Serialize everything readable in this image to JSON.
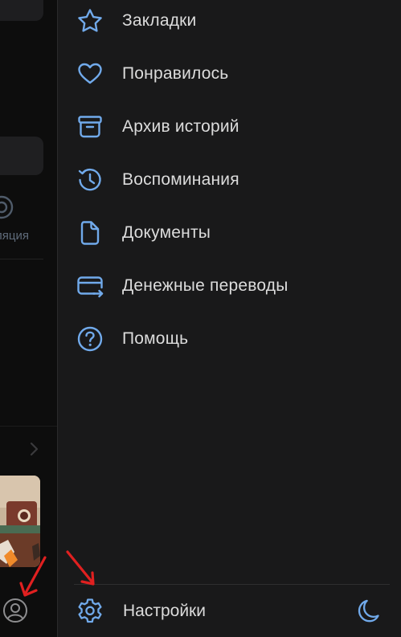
{
  "background_app": {
    "tab_label": "ляция"
  },
  "menu": {
    "items": [
      {
        "label": "Закладки",
        "icon": "star-icon"
      },
      {
        "label": "Понравилось",
        "icon": "heart-icon"
      },
      {
        "label": "Архив историй",
        "icon": "archive-box-icon"
      },
      {
        "label": "Воспоминания",
        "icon": "history-clock-icon"
      },
      {
        "label": "Документы",
        "icon": "document-icon"
      },
      {
        "label": "Денежные переводы",
        "icon": "card-transfer-icon"
      },
      {
        "label": "Помощь",
        "icon": "question-circle-icon"
      }
    ]
  },
  "footer": {
    "settings_label": "Настройки",
    "settings_icon": "gear-icon",
    "theme_icon": "moon-icon"
  },
  "colors": {
    "accent": "#71aaeb",
    "text": "#dcdcdc",
    "background": "#19191a",
    "annotation_arrow": "#e02020"
  }
}
